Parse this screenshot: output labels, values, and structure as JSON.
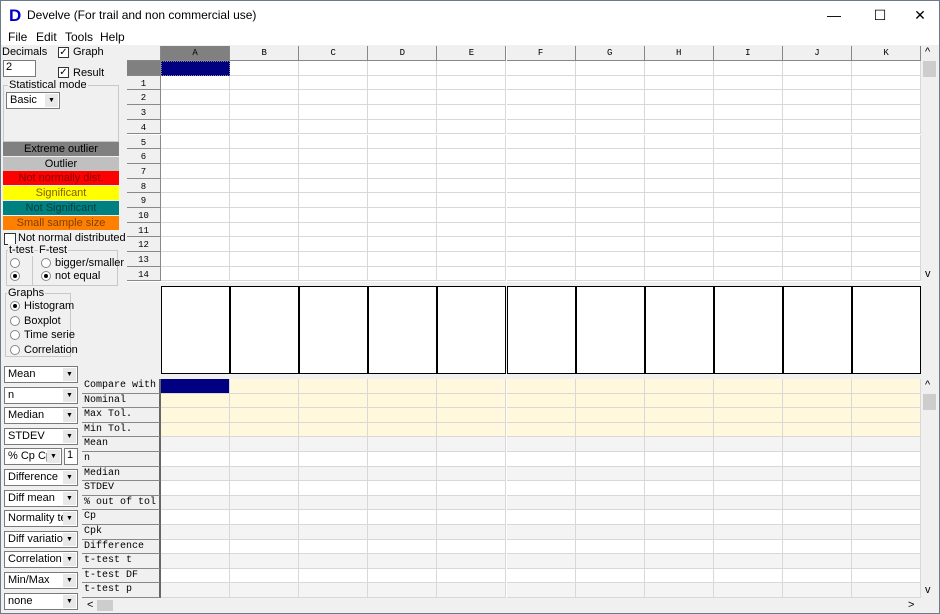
{
  "window": {
    "title": "Develve (For trail and non commercial use)",
    "logo": "D",
    "minimize": "—",
    "maximize": "☐",
    "close": "✕"
  },
  "menu": [
    "File",
    "Edit",
    "Tools",
    "Help"
  ],
  "options": {
    "decimals_label": "Decimals",
    "decimals_value": "2",
    "graph_label": "Graph",
    "graph_checked": true,
    "result_label": "Result",
    "result_checked": true,
    "stat_mode_label": "Statistical mode",
    "stat_mode_value": "Basic"
  },
  "legend_items": [
    {
      "label": "Extreme outlier",
      "bg": "#808080",
      "fg": "#000000"
    },
    {
      "label": "Outlier",
      "bg": "#c0c0c0",
      "fg": "#000000"
    },
    {
      "label": "Not normally dist.",
      "bg": "#ff0000",
      "fg": "#800000"
    },
    {
      "label": "Significant",
      "bg": "#ffff00",
      "fg": "#806000"
    },
    {
      "label": "Not Significant",
      "bg": "#008080",
      "fg": "#004040"
    },
    {
      "label": "Small sample size",
      "bg": "#ff8000",
      "fg": "#804000"
    }
  ],
  "not_normal": {
    "label": "Not normal distributed",
    "checked": false
  },
  "tests": {
    "ttest_label": "t-test",
    "ftest_label": "F-test",
    "bigger_label": "bigger/smaller",
    "notequal_label": "not equal",
    "selected": "not equal"
  },
  "graphs": {
    "label": "Graphs",
    "options": [
      "Histogram",
      "Boxplot",
      "Time serie",
      "Correlation"
    ],
    "selected": "Histogram"
  },
  "combos": [
    "Mean",
    "n",
    "Median",
    "STDEV",
    "% Cp Cpk",
    "Difference",
    "Diff mean",
    "Normality test",
    "Diff variation",
    "Correlation",
    "Min/Max",
    "none"
  ],
  "cpk_value": "1",
  "columns": [
    "A",
    "B",
    "C",
    "D",
    "E",
    "F",
    "G",
    "H",
    "I",
    "J",
    "K"
  ],
  "rows": [
    "",
    "1",
    "2",
    "3",
    "4",
    "5",
    "6",
    "7",
    "8",
    "9",
    "10",
    "11",
    "12",
    "13",
    "14"
  ],
  "result_rows": [
    "Compare with",
    "Nominal",
    "Max Tol.",
    "Min Tol.",
    "Mean",
    "n",
    "Median",
    "STDEV",
    "% out of tol",
    "Cp",
    "Cpk",
    "Difference",
    "t-test t",
    "t-test DF",
    "t-test p"
  ],
  "colors": {
    "selection": "#000080",
    "tolerance_bg": "#fff8dc",
    "alt_row": "#f4f4f4"
  },
  "scroll": {
    "up": "^",
    "down": "v",
    "left": "<",
    "right": ">"
  }
}
